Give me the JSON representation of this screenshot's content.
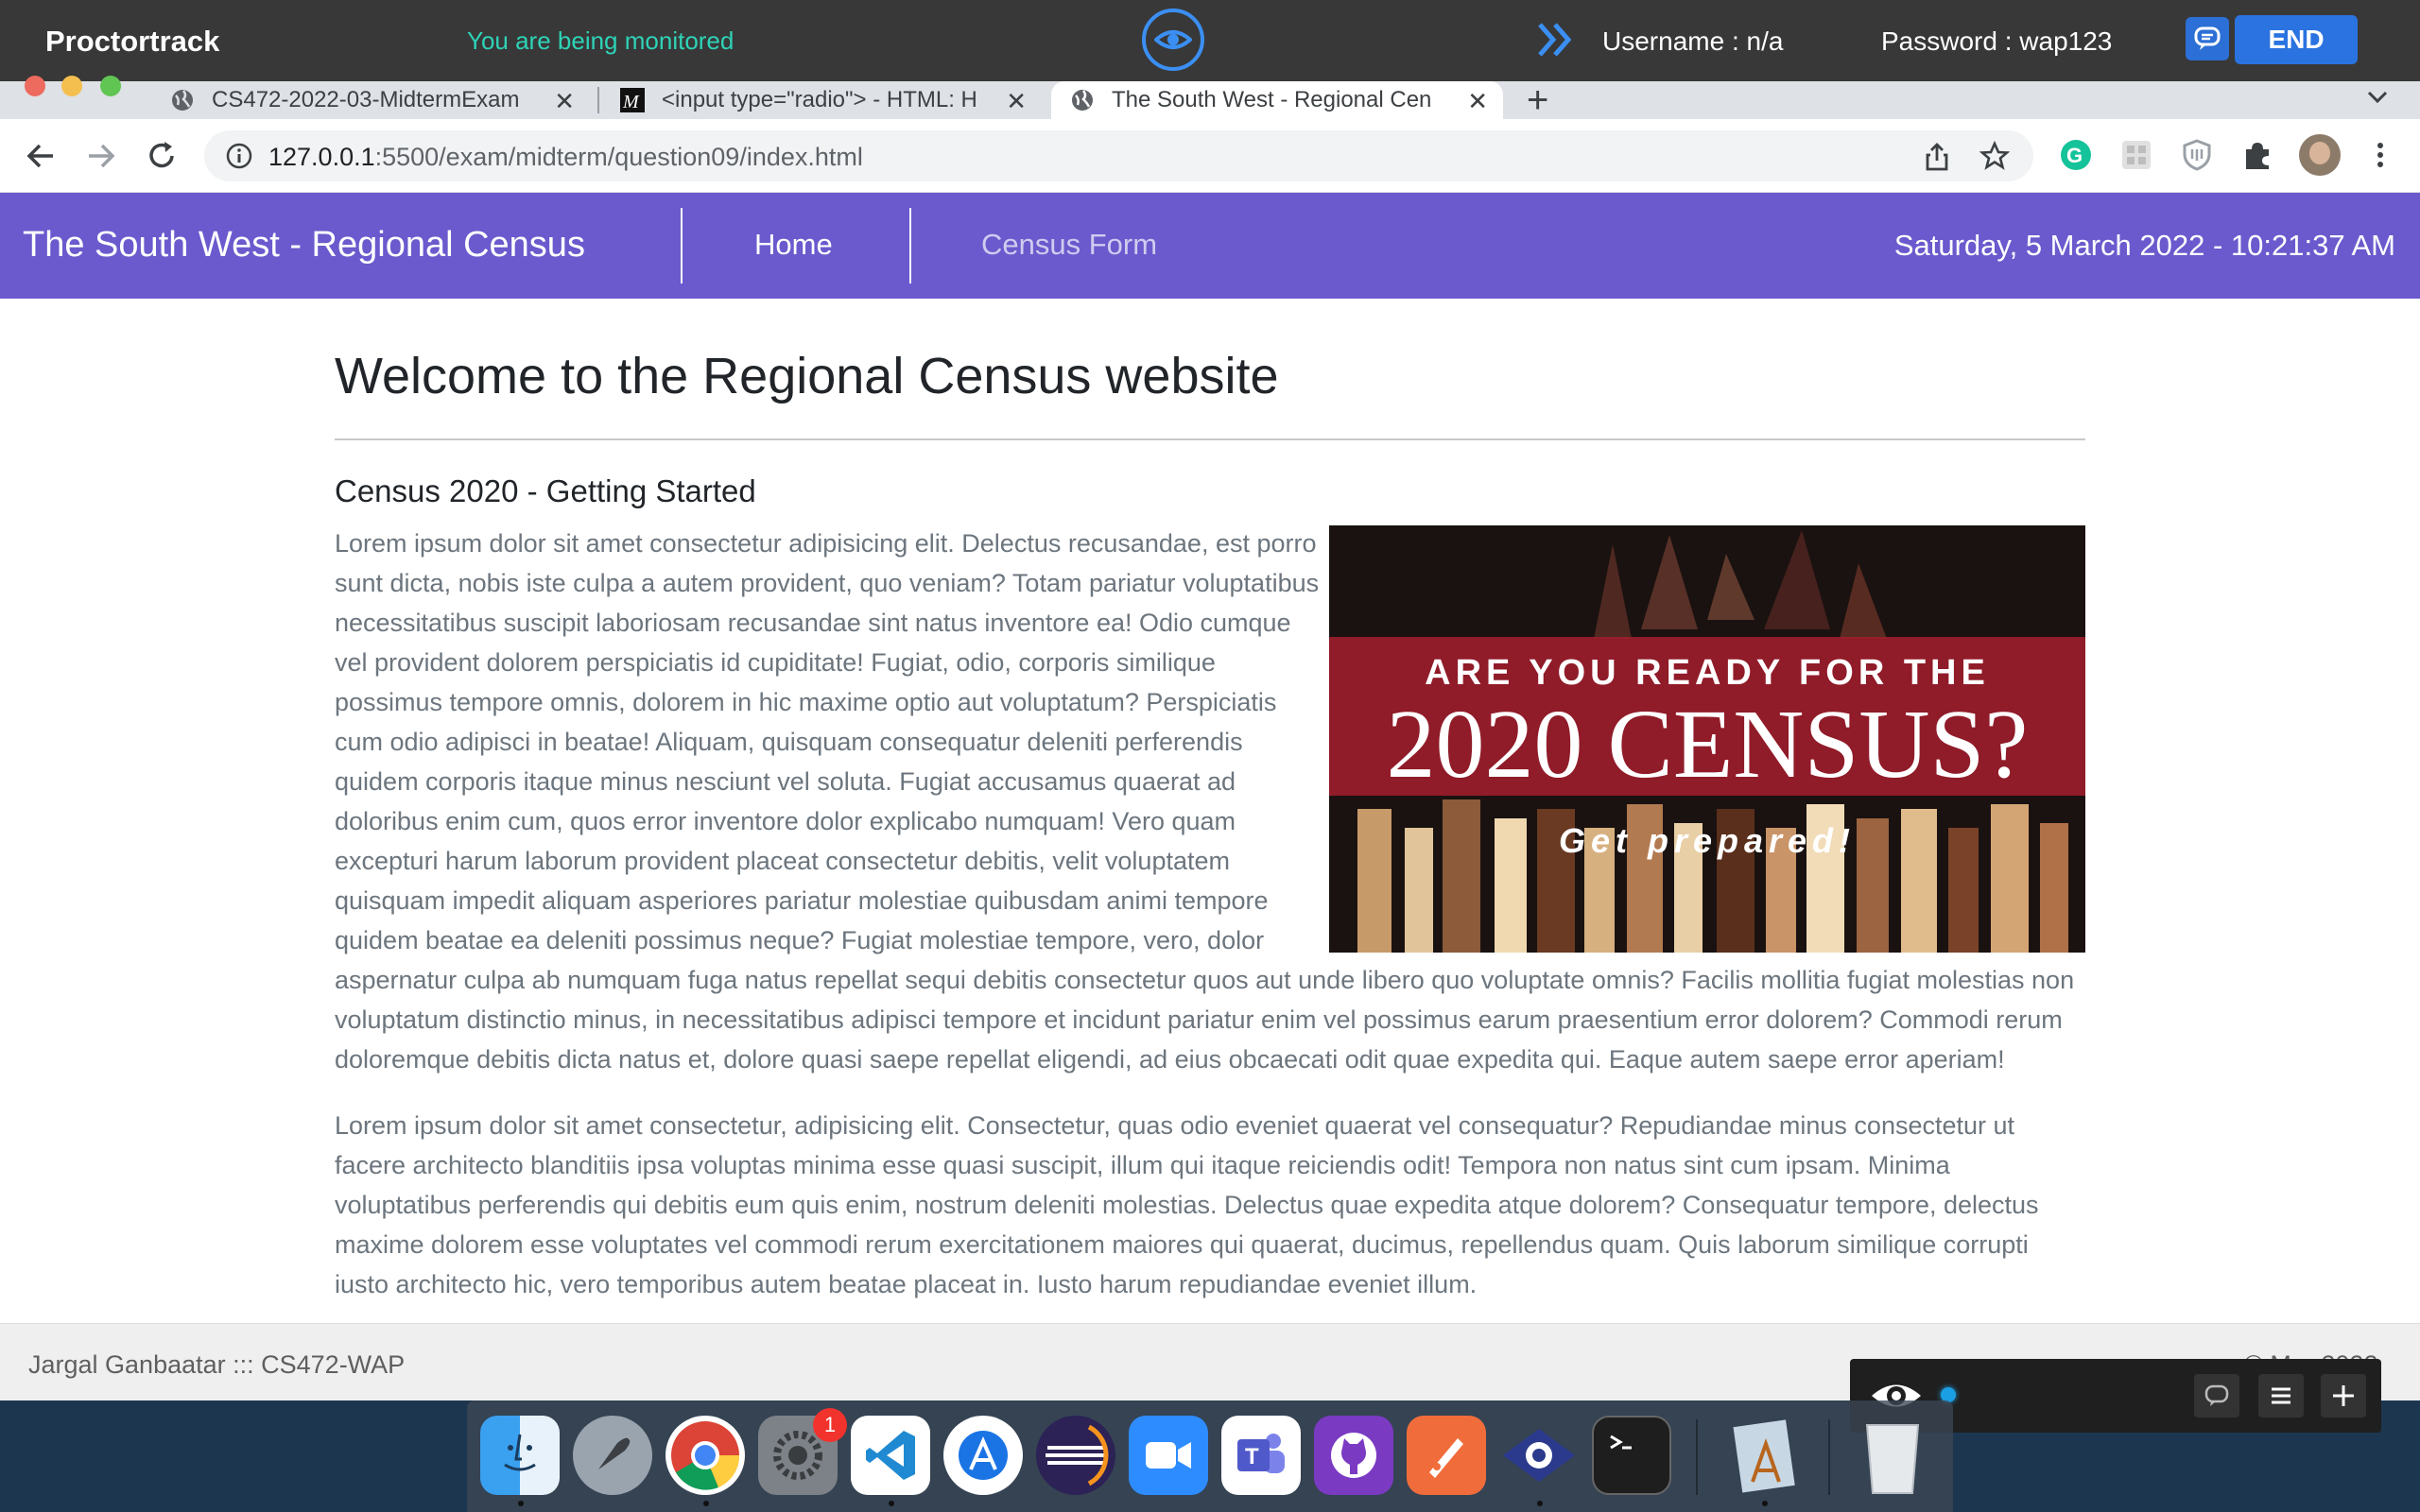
{
  "proctor": {
    "logo": "Proctortrack",
    "status": "You are being monitored",
    "username": "Username : n/a",
    "password": "Password : wap123",
    "end_label": "END"
  },
  "tabs": [
    {
      "title": "CS472-2022-03-MidtermExam",
      "icon": "globe-icon",
      "active": false
    },
    {
      "title": "<input type=\"radio\"> - HTML: H",
      "icon": "mdn-icon",
      "active": false
    },
    {
      "title": "The South West - Regional Cen",
      "icon": "globe-icon",
      "active": true
    }
  ],
  "address": {
    "host": "127.0.0.1",
    "rest": ":5500/exam/midterm/question09/index.html"
  },
  "site": {
    "brand": "The South West - Regional Census",
    "nav": [
      {
        "label": "Home",
        "active": true
      },
      {
        "label": "Census Form",
        "active": false
      }
    ],
    "datetime": "Saturday, 5 March 2022 - 10:21:37 AM",
    "heading": "Welcome to the Regional Census website",
    "subheading": "Census 2020 - Getting Started",
    "paragraph1": "Lorem ipsum dolor sit amet consectetur adipisicing elit. Delectus recusandae, est porro sunt dicta, nobis iste culpa a autem provident, quo veniam? Totam pariatur voluptatibus necessitatibus suscipit laboriosam recusandae sint natus inventore ea! Odio cumque vel provident dolorem perspiciatis id cupiditate! Fugiat, odio, corporis similique possimus tempore omnis, dolorem in hic maxime optio aut voluptatum? Perspiciatis cum odio adipisci in beatae! Aliquam, quisquam consequatur deleniti perferendis quidem corporis itaque minus nesciunt vel soluta. Fugiat accusamus quaerat ad doloribus enim cum, quos error inventore dolor explicabo numquam! Vero quam excepturi harum laborum provident placeat consectetur debitis, velit voluptatem quisquam impedit aliquam asperiores pariatur molestiae quibusdam animi tempore quidem beatae ea deleniti possimus neque? Fugiat molestiae tempore, vero, dolor aspernatur culpa ab numquam fuga natus repellat sequi debitis consectetur quos aut unde libero quo voluptate omnis? Facilis mollitia fugiat molestias non voluptatum distinctio minus, in necessitatibus adipisci tempore et incidunt pariatur enim vel possimus earum praesentium error dolorem? Commodi rerum doloremque debitis dicta natus et, dolore quasi saepe repellat eligendi, ad eius obcaecati odit quae expedita qui. Eaque autem saepe error aperiam!",
    "paragraph2": "Lorem ipsum dolor sit amet consectetur, adipisicing elit. Consectetur, quas odio eveniet quaerat vel consequatur? Repudiandae minus consectetur ut facere architecto blanditiis ipsa voluptas minima esse quasi suscipit, illum qui itaque reiciendis odit! Tempora non natus sint cum ipsam. Minima voluptatibus perferendis qui debitis eum quis enim, nostrum deleniti molestias. Delectus quae expedita atque dolorem? Consequatur tempore, delectus maxime dolorem esse voluptates vel commodi rerum exercitationem maiores qui quaerat, ducimus, repellendus quam. Quis laborum similique corrupti iusto architecto hic, vero temporibus autem beatae placeat in. Iusto harum repudiandae eveniet illum.",
    "banner": {
      "line1": "ARE YOU READY FOR THE",
      "line2": "2020 CENSUS?",
      "line3": "Get prepared!"
    },
    "footer_left": "Jargal Ganbaatar ::: CS472-WAP",
    "footer_right": "© Mar 2022"
  },
  "dock": {
    "apps": [
      "Finder",
      "Launchpad",
      "Google Chrome",
      "System Preferences",
      "Visual Studio Code",
      "Xcode",
      "Eclipse",
      "Zoom",
      "Microsoft Teams",
      "GitHub Desktop",
      "Postman",
      "Proctortrack",
      "Terminal",
      "Preview",
      "Trash"
    ],
    "prefs_badge": "1"
  },
  "colors": {
    "site_nav": "#6a5acd",
    "proctor_accent": "#2a73e0",
    "monitored_text": "#2ed3b7"
  }
}
